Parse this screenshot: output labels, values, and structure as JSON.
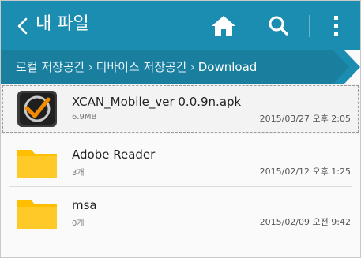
{
  "appbar": {
    "title": "내 파일",
    "actions": [
      {
        "icon": "home-icon"
      },
      {
        "icon": "search-icon"
      },
      {
        "icon": "more-vertical-icon"
      }
    ],
    "color": "#1b8db0"
  },
  "breadcrumb": {
    "items": [
      "로컬 저장공간",
      "디바이스 저장공간",
      "Download"
    ],
    "separator": "›",
    "color": "#1a7e9e"
  },
  "files": [
    {
      "name": "XCAN_Mobile_ver 0.0.9n.apk",
      "meta": "6.9MB",
      "date": "2015/03/27 오후 2:05",
      "icon": "apk-app-icon",
      "selected": true
    },
    {
      "name": "Adobe Reader",
      "meta": "3개",
      "date": "2015/02/12 오후 1:25",
      "icon": "folder-icon",
      "selected": false
    },
    {
      "name": "msa",
      "meta": "0개",
      "date": "2015/02/09 오전 9:42",
      "icon": "folder-icon",
      "selected": false
    }
  ],
  "colors": {
    "folder": "#ffc107",
    "accent": "#1b8db0"
  }
}
